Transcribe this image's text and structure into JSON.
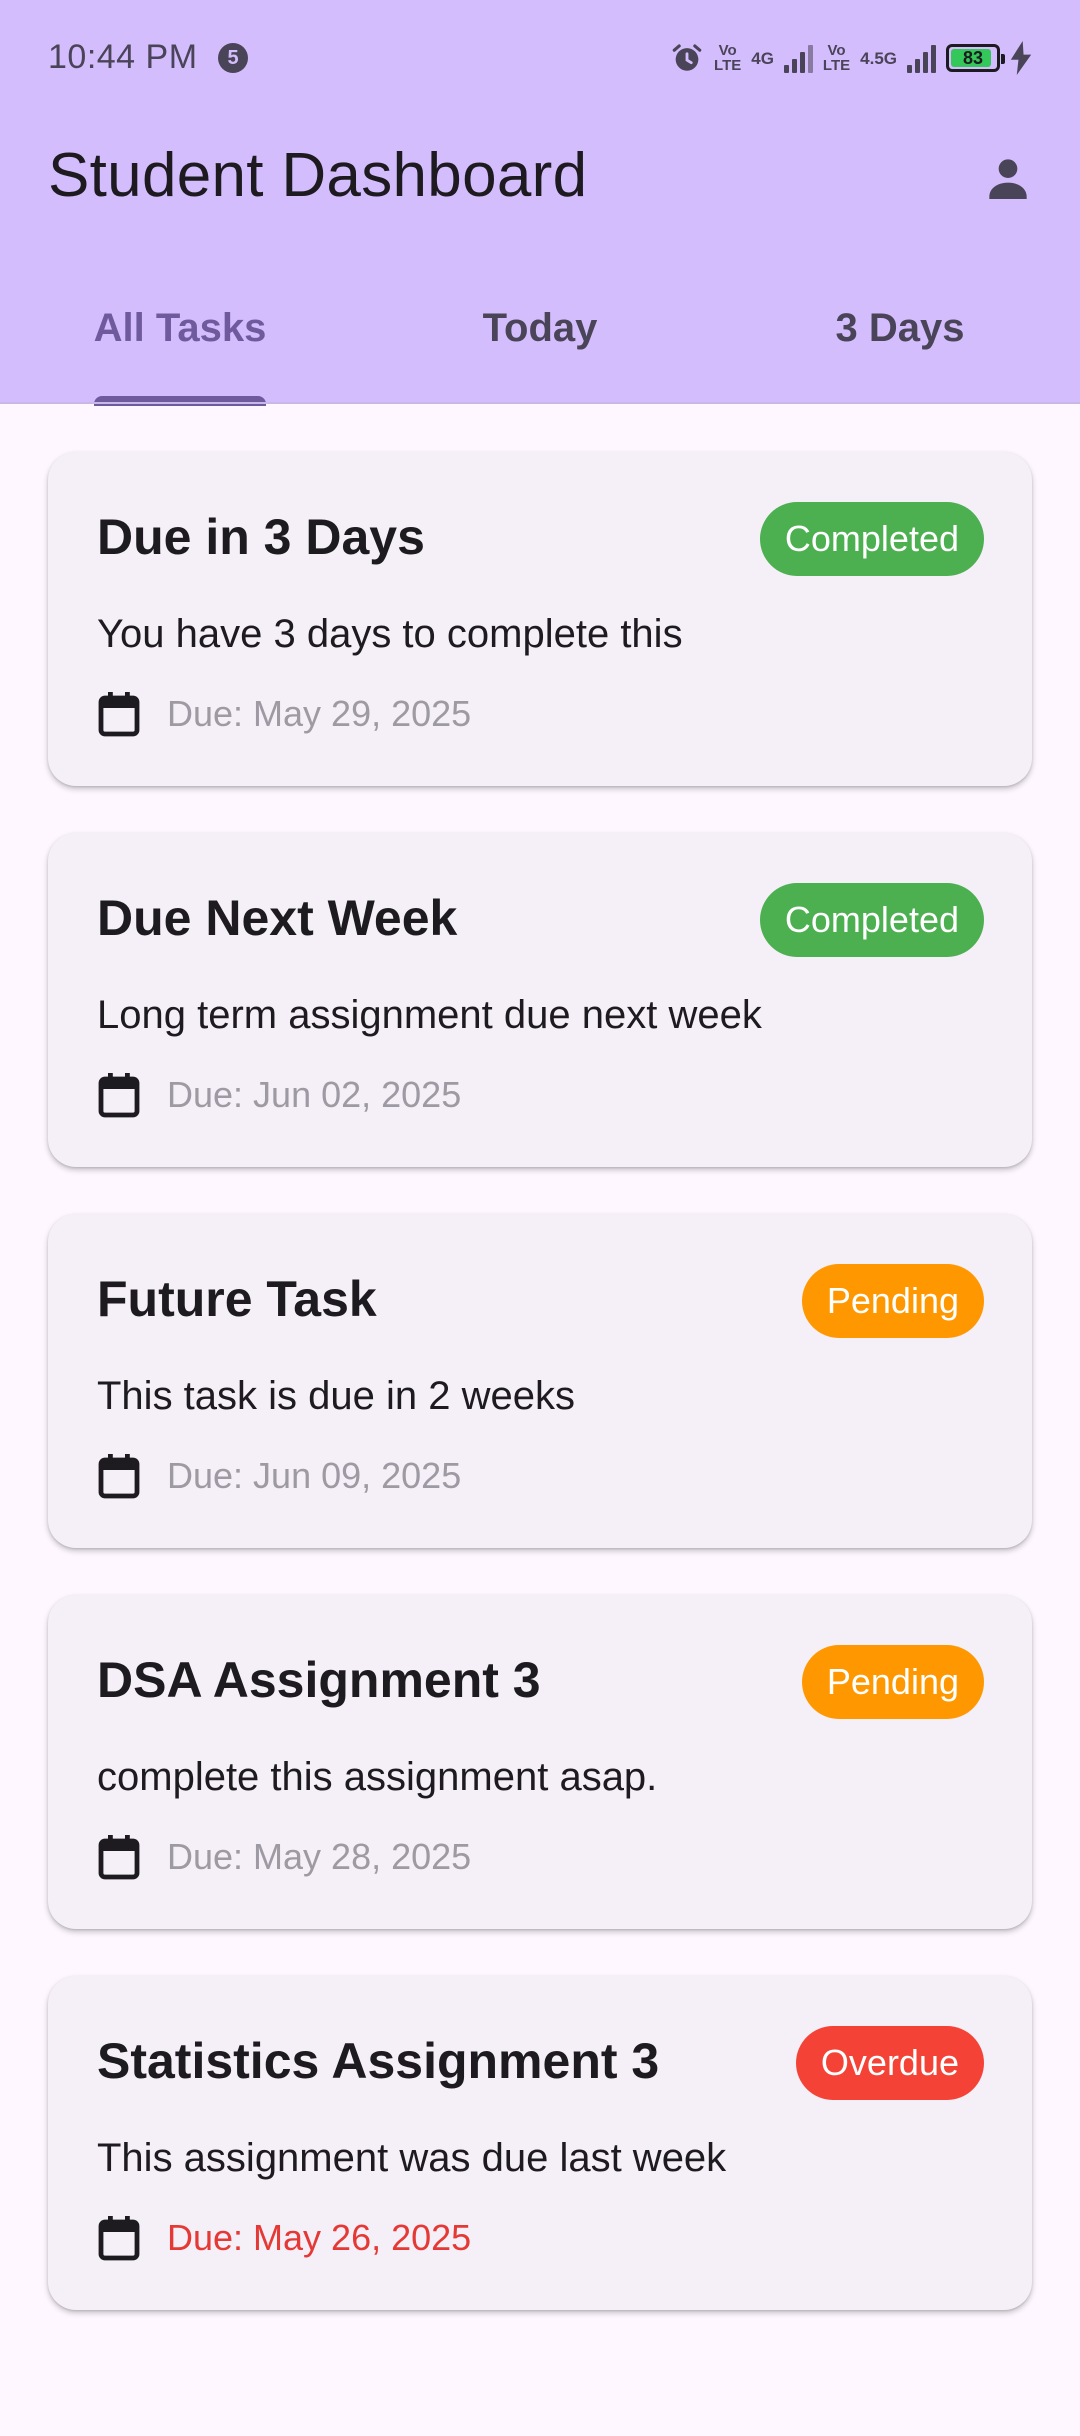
{
  "status_bar": {
    "time": "10:44 PM",
    "notification_count": "5",
    "network_1_top": "Vo",
    "network_1_bottom": "LTE",
    "network_1_type": "4G",
    "network_2_top": "Vo",
    "network_2_bottom": "LTE",
    "network_2_type": "4.5G",
    "battery_level": "83",
    "icons": [
      "alarm-icon",
      "signal-icon",
      "signal-icon",
      "battery-icon",
      "charging-icon"
    ]
  },
  "app_bar": {
    "title": "Student Dashboard",
    "profile_icon": "person-icon"
  },
  "tabs": [
    {
      "label": "All Tasks",
      "active": true
    },
    {
      "label": "Today",
      "active": false
    },
    {
      "label": "3 Days",
      "active": false
    }
  ],
  "tasks": [
    {
      "title": "Due in 3 Days",
      "status": "Completed",
      "description": "You have 3 days to complete this",
      "due": "Due: May 29, 2025"
    },
    {
      "title": "Due Next Week",
      "status": "Completed",
      "description": "Long term assignment due next week",
      "due": "Due: Jun 02, 2025"
    },
    {
      "title": "Future Task",
      "status": "Pending",
      "description": "This task is due in 2 weeks",
      "due": "Due: Jun 09, 2025"
    },
    {
      "title": "DSA Assignment 3",
      "status": "Pending",
      "description": "complete this assignment asap.",
      "due": "Due: May 28, 2025"
    },
    {
      "title": "Statistics Assignment 3",
      "status": "Overdue",
      "description": "This assignment was due last week",
      "due": "Due: May 26, 2025"
    }
  ],
  "colors": {
    "app_bar_bg": "#d4bdfd",
    "page_bg": "#fef7ff",
    "card_bg": "#f5eff7",
    "tab_active": "#6f5a9e",
    "completed": "#4caf50",
    "pending": "#ff9800",
    "overdue": "#f44336"
  }
}
